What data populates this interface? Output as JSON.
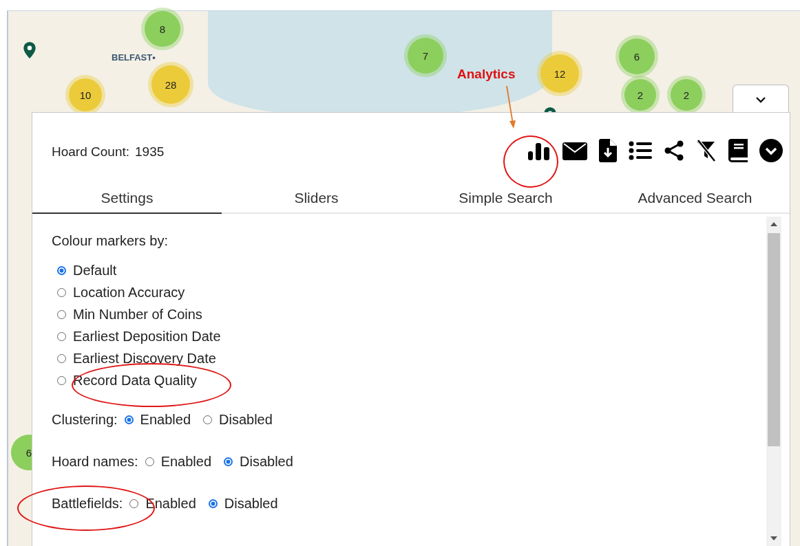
{
  "map": {
    "city_label": "BELFAST•",
    "clusters": [
      {
        "count": "8",
        "color": "#8ccf5d"
      },
      {
        "count": "7",
        "color": "#8ccf5d"
      },
      {
        "count": "6",
        "color": "#8ccf5d"
      },
      {
        "count": "12",
        "color": "#eccb3a"
      },
      {
        "count": "10",
        "color": "#eccb3a"
      },
      {
        "count": "28",
        "color": "#eccb3a"
      },
      {
        "count": "2",
        "color": "#8ccf5d"
      },
      {
        "count": "2",
        "color": "#8ccf5d"
      },
      {
        "count": "6",
        "color": "#8ccf5d"
      }
    ]
  },
  "panel_toggle": {
    "expanded": true
  },
  "panel": {
    "hoard_count_label": "Hoard Count:",
    "hoard_count": "1935",
    "tabs": [
      {
        "label": "Settings",
        "selected": true
      },
      {
        "label": "Sliders",
        "selected": false
      },
      {
        "label": "Simple Search",
        "selected": false
      },
      {
        "label": "Advanced Search",
        "selected": false
      }
    ],
    "colour_markers": {
      "label": "Colour markers by:",
      "options": [
        {
          "label": "Default",
          "selected": true
        },
        {
          "label": "Location Accuracy",
          "selected": false
        },
        {
          "label": "Min Number of Coins",
          "selected": false
        },
        {
          "label": "Earliest Deposition Date",
          "selected": false
        },
        {
          "label": "Earliest Discovery Date",
          "selected": false
        },
        {
          "label": "Record Data Quality",
          "selected": false
        }
      ]
    },
    "settings": [
      {
        "label": "Clustering:",
        "options": [
          {
            "label": "Enabled",
            "selected": true
          },
          {
            "label": "Disabled",
            "selected": false
          }
        ]
      },
      {
        "label": "Hoard names:",
        "options": [
          {
            "label": "Enabled",
            "selected": false
          },
          {
            "label": "Disabled",
            "selected": true
          }
        ]
      },
      {
        "label": "Battlefields:",
        "options": [
          {
            "label": "Enabled",
            "selected": false
          },
          {
            "label": "Disabled",
            "selected": true
          }
        ]
      }
    ]
  },
  "annotation": {
    "label": "Analytics"
  }
}
